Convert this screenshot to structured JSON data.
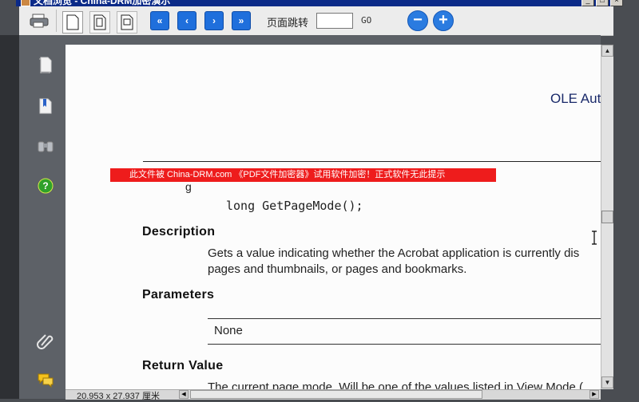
{
  "window": {
    "title": "文档浏览 - China-DRM加密演示"
  },
  "toolbar": {
    "jump_label": "页面跳转",
    "jump_value": "",
    "go_label": "GO",
    "nav": {
      "first": "«",
      "prev": "‹",
      "next": "›",
      "last": "»"
    },
    "zoom_out": "−",
    "zoom_in": "+"
  },
  "sidebar": {
    "icons": [
      "pages-icon",
      "bookmark-icon",
      "binoculars-icon",
      "help-icon",
      "attachment-icon",
      "comments-icon"
    ]
  },
  "document": {
    "header_title": "OLE Auto",
    "watermark": "此文件被 China-DRM.com 《PDF文件加密器》试用软件加密！正式软件无此提示",
    "partial_heading": "g",
    "code_line": "long GetPageMode();",
    "description_heading": "Description",
    "description_line1": "Gets a value indicating whether the Acrobat application is currently dis",
    "description_line2": "pages and thumbnails, or pages and bookmarks.",
    "parameters_heading": "Parameters",
    "parameters_value": "None",
    "return_heading": "Return Value",
    "return_line": "The current page mode. Will be one of the values listed in View Mode ("
  },
  "status": {
    "page_size": "20.953 x 27.937 厘米"
  },
  "colors": {
    "watermark_red": "#ee1c1c",
    "nav_blue": "#1f6fdc",
    "header_navy": "#1a2a6a"
  }
}
